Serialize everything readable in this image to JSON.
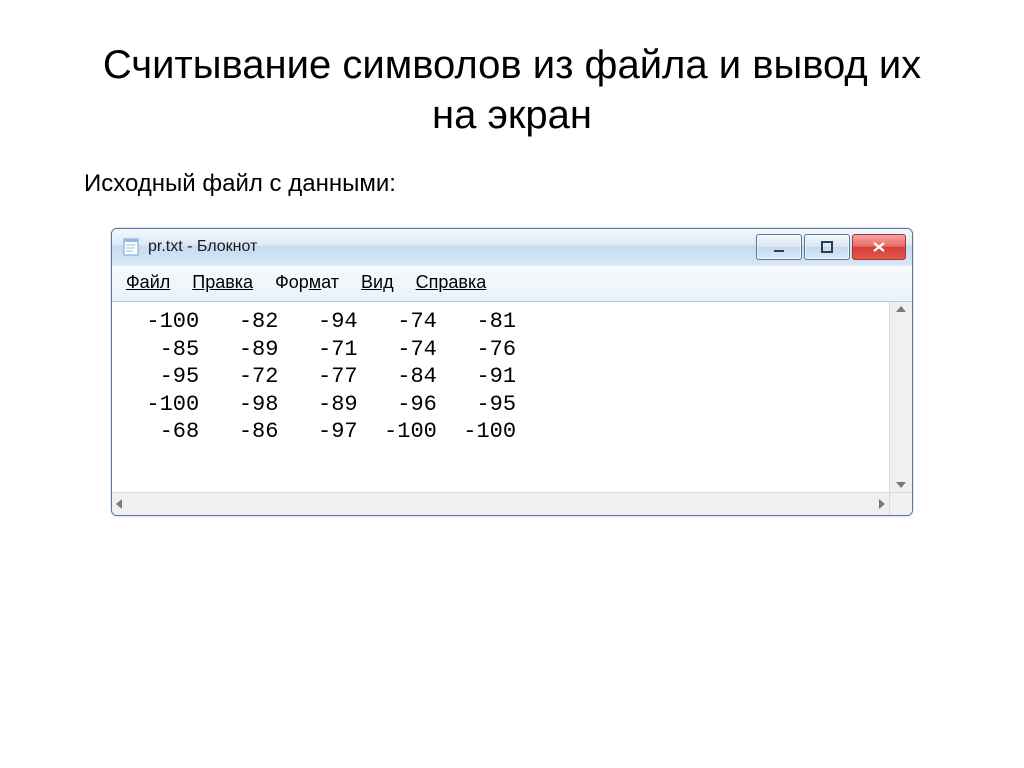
{
  "slide": {
    "title": "Считывание символов из файла и вывод их на экран",
    "subtitle": "Исходный файл с данными:"
  },
  "window": {
    "title": "pr.txt - Блокнот",
    "menu": {
      "file": "Файл",
      "edit": "Правка",
      "format": "Формат",
      "view": "Вид",
      "help": "Справка"
    },
    "content_rows": [
      [
        -100,
        -82,
        -94,
        -74,
        -81
      ],
      [
        -85,
        -89,
        -71,
        -74,
        -76
      ],
      [
        -95,
        -72,
        -77,
        -84,
        -91
      ],
      [
        -100,
        -98,
        -89,
        -96,
        -95
      ],
      [
        -68,
        -86,
        -97,
        -100,
        -100
      ]
    ]
  }
}
